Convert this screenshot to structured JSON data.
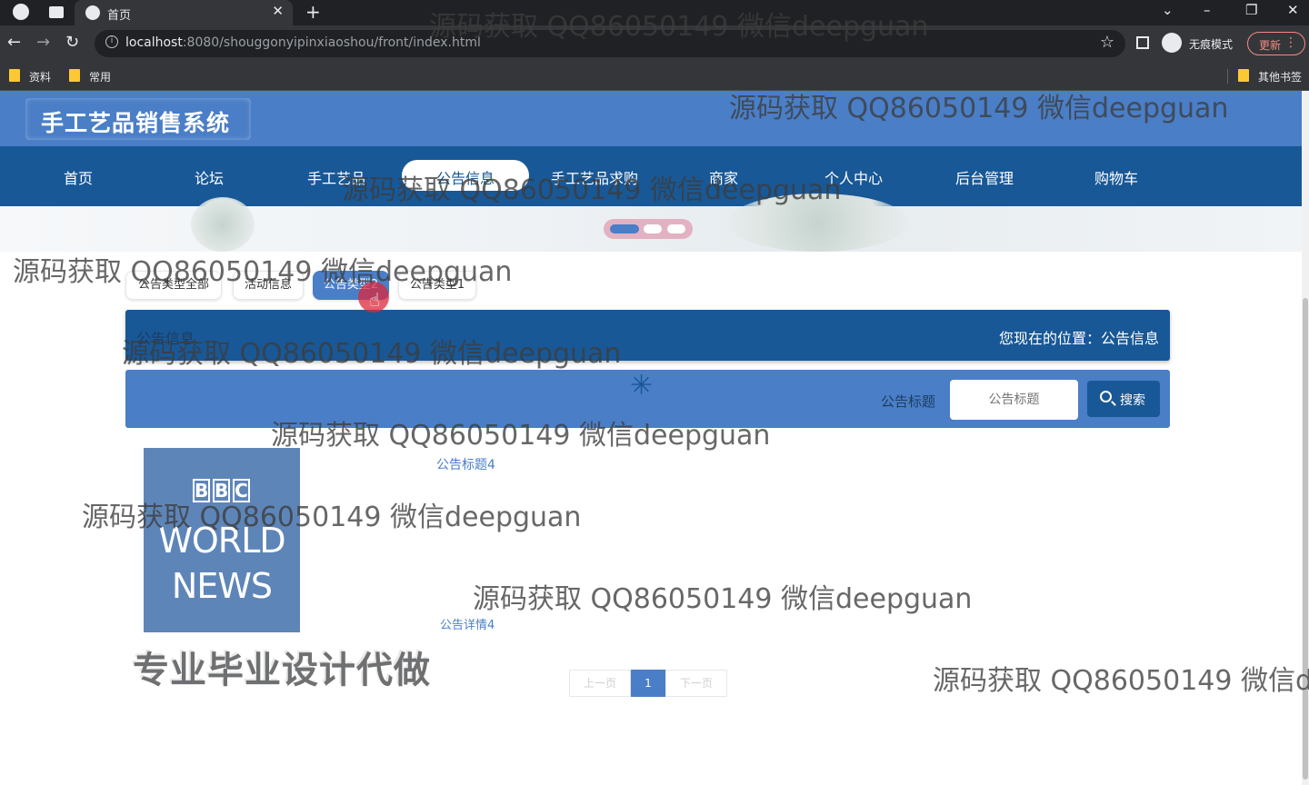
{
  "browser": {
    "tab_title": "首页",
    "url_host": "localhost",
    "url_path": ":8080/shouggonyipinxiaoshou/front/index.html",
    "profile_label": "无痕模式",
    "update_label": "更新",
    "bookmarks": [
      "资料",
      "常用"
    ],
    "other_bookmarks": "其他书签"
  },
  "site": {
    "title": "手工艺品销售系统",
    "nav": [
      "首页",
      "论坛",
      "手工艺品",
      "公告信息",
      "手工艺品求购",
      "商家",
      "个人中心",
      "后台管理",
      "购物车"
    ],
    "active_nav": "公告信息"
  },
  "filters": {
    "tabs": [
      "公告类型全部",
      "活动信息",
      "公告类型2",
      "公告类型1"
    ],
    "active": "公告类型2"
  },
  "breadcrumb": {
    "title": "公告信息",
    "position": "您现在的位置：公告信息"
  },
  "search": {
    "label": "公告标题",
    "placeholder": "公告标题",
    "button": "搜索"
  },
  "news": {
    "thumb_line1": "WORLD",
    "thumb_line2": "NEWS",
    "thumb_logo": [
      "B",
      "B",
      "C"
    ],
    "title": "公告标题4",
    "detail": "公告详情4"
  },
  "promo_text": "专业毕业设计代做",
  "pager": {
    "prev": "上一页",
    "current": "1",
    "next": "下一页"
  },
  "watermark": "源码获取 QQ86050149 微信deepguan",
  "colors": {
    "header": "#4a7ec7",
    "nav": "#195896",
    "accent": "#4a7ec7"
  }
}
